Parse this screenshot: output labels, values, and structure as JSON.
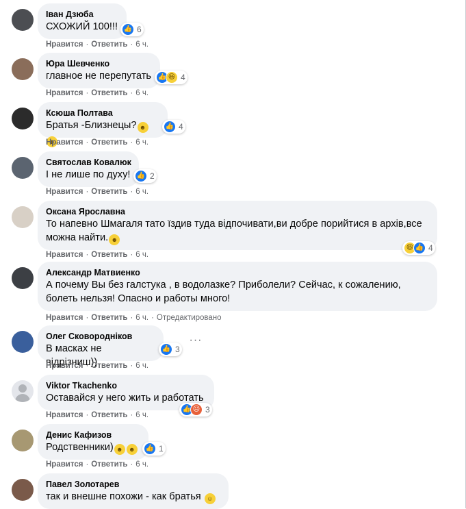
{
  "labels": {
    "like": "Нравится",
    "reply": "Ответить",
    "dot": "·",
    "edited": "Отредактировано"
  },
  "comments": [
    {
      "author": "Іван Дзюба",
      "text": "СХОЖИЙ 100!!!",
      "time": "6 ч.",
      "reaction_count": "6",
      "reactions": [
        "like-icon"
      ],
      "avatar": "avatar"
    },
    {
      "author": "Юра Шевченко",
      "text": "главное не перепутать",
      "time": "6 ч.",
      "reaction_count": "4",
      "reactions": [
        "like-icon",
        "haha-icon"
      ],
      "avatar": "avatar"
    },
    {
      "author": "Ксюша Полтава",
      "text": "Братья -Близнецы?",
      "time": "6 ч.",
      "reaction_count": "4",
      "reactions": [
        "like-icon"
      ],
      "inline_emoji": [
        "grin-emoji",
        "grin-emoji"
      ],
      "avatar": "avatar"
    },
    {
      "author": "Святослав Ковалюк",
      "text": "І не лише по духу!",
      "time": "6 ч.",
      "reaction_count": "2",
      "reactions": [
        "like-icon"
      ],
      "avatar": "avatar"
    },
    {
      "author": "Оксана Ярославна",
      "text": "То напевно Шмагаля тато їздив туда відпочивати,ви добре порийтися в архів,все\nможна найти.",
      "time": "6 ч.",
      "reaction_count": "4",
      "reactions": [
        "haha-icon",
        "like-icon"
      ],
      "inline_emoji": [
        "rofl-emoji"
      ],
      "avatar": "avatar"
    },
    {
      "author": "Александр Матвиенко",
      "text": "А почему Вы без галстука , в водолазке? Приболели? Сейчас, к сожалению,\nболеть нельзя! Опасно и работы много!",
      "time": "6 ч.",
      "reaction_count": "",
      "reactions": [],
      "edited": true,
      "avatar": "avatar"
    },
    {
      "author": "Олег Сковороднiков",
      "text": "В масках не відрізниш))",
      "time": "6 ч.",
      "reaction_count": "3",
      "reactions": [
        "like-icon"
      ],
      "avatar": "avatar",
      "more": "···"
    },
    {
      "author": "Viktor Tkachenko",
      "text": "Оставайся у него жить и работать",
      "time": "6 ч.",
      "reaction_count": "3",
      "reactions": [
        "like-icon",
        "angry-icon"
      ],
      "avatar": "generic"
    },
    {
      "author": "Денис Кафизов",
      "text": "Родственники)",
      "time": "6 ч.",
      "reaction_count": "1",
      "reactions": [
        "like-icon"
      ],
      "inline_emoji": [
        "thumbs-up-emoji",
        "clap-emoji"
      ],
      "avatar": "avatar"
    },
    {
      "author": "Павел Золотарев",
      "text": "так и внешне похожи - как братья",
      "time": "",
      "reaction_count": "",
      "reactions": [],
      "inline_emoji": [
        "smile-emoji"
      ],
      "avatar": "avatar"
    }
  ]
}
